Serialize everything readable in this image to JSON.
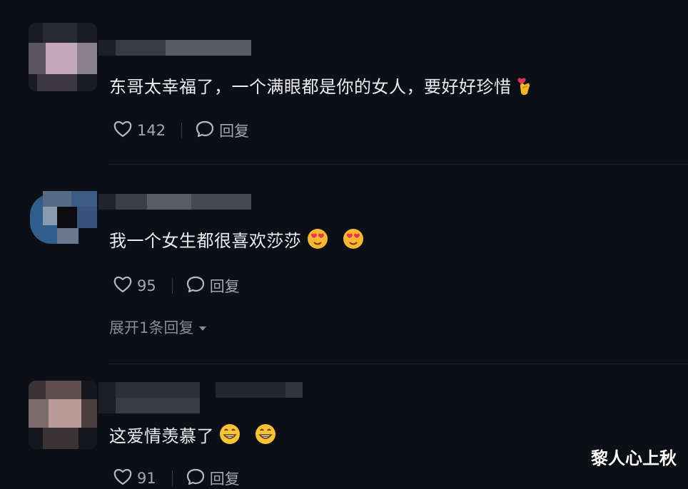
{
  "comments": [
    {
      "text": "东哥太幸福了，一个满眼都是你的女人，要好好珍惜",
      "emoji": [
        "finger-heart"
      ],
      "likes": "142",
      "reply_label": "回复"
    },
    {
      "text": "我一个女生都很喜欢莎莎",
      "emoji": [
        "heart-eyes",
        "heart-eyes"
      ],
      "likes": "95",
      "reply_label": "回复",
      "expand_label": "展开1条回复"
    },
    {
      "text": "这爱情羡慕了",
      "emoji": [
        "grin",
        "grin"
      ],
      "likes": "91",
      "reply_label": "回复"
    }
  ],
  "watermark": "黎人心上秋",
  "colors": {
    "background": "#0d0f16",
    "text": "#ececf1",
    "muted": "#a6a7ae"
  }
}
